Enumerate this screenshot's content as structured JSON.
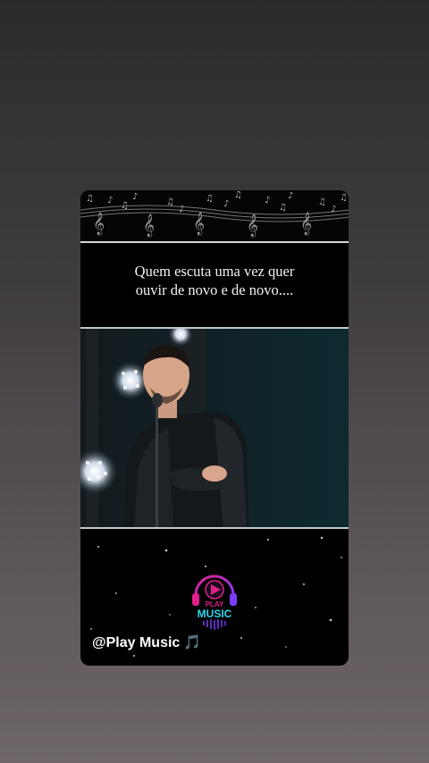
{
  "story": {
    "quote_line1": "Quem escuta uma vez quer",
    "quote_line2": "ouvir de novo e de novo....",
    "handle": "@Play Music",
    "handle_emoji": "🎵",
    "logo_line1": "PLAY",
    "logo_line2": "MUSIC",
    "notes_icon": "treble-clef-icon",
    "colors": {
      "logo_pink": "#e0208a",
      "logo_cyan": "#2fd6f0",
      "logo_purple": "#7a3cff"
    }
  }
}
